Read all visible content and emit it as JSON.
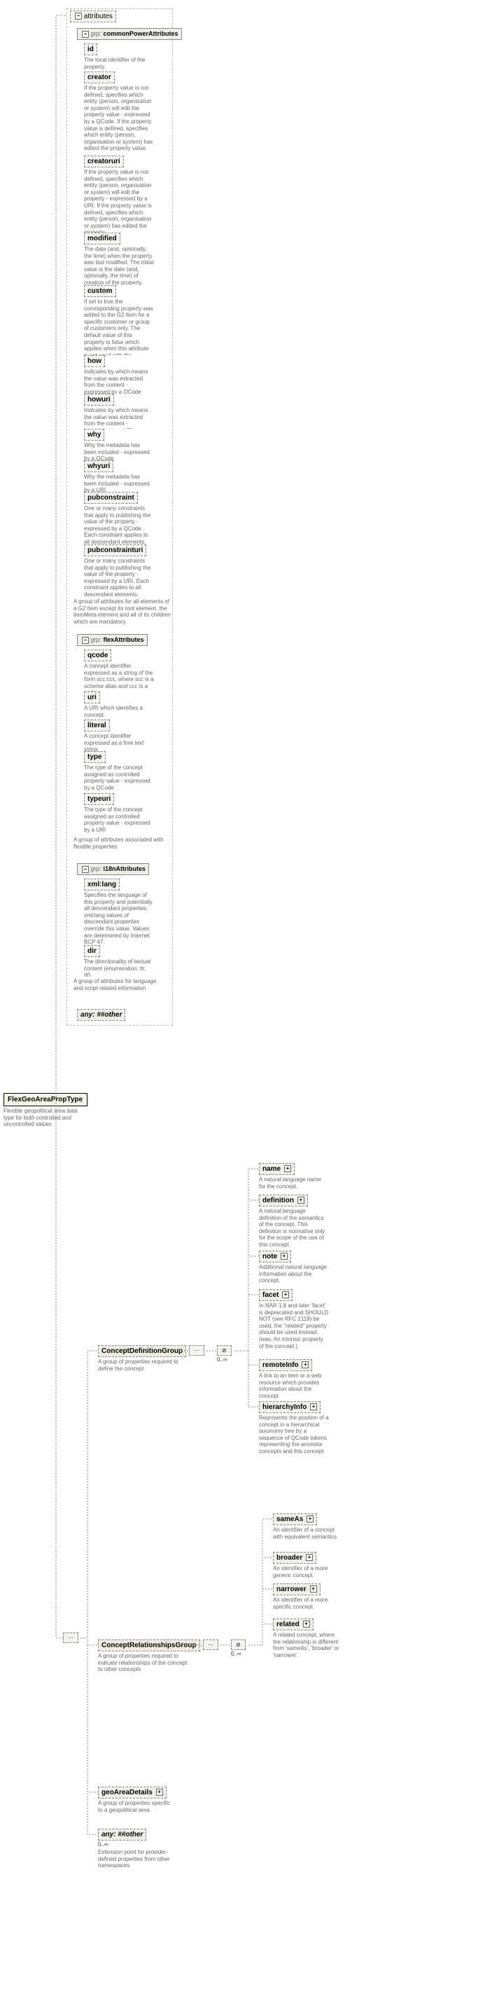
{
  "root": {
    "name": "FlexGeoAreaPropType",
    "desc": "Flexible geopolitical area data type for both controlled and uncontrolled values"
  },
  "attributes_label": "attributes",
  "grp_prefix": "grp:",
  "any_prefix": "any:",
  "toggle_plus": "+",
  "toggle_minus": "−",
  "seq_dots": "···",
  "groups": {
    "commonPower": {
      "name": "commonPowerAttributes",
      "desc": "A group of attributes for all elements of a G2 Item except its root element, the itemMeta element and all of its children which are mandatory.",
      "attrs": [
        {
          "name": "id",
          "desc": "The local identifier of the property."
        },
        {
          "name": "creator",
          "desc": "If the property value is not defined, specifies which entity (person, organisation or system) will edit the property value - expressed by a QCode. If the property value is defined, specifies which entity (person, organisation or system) has edited the property value."
        },
        {
          "name": "creatoruri",
          "desc": "If the property value is not defined, specifies which entity (person, organisation or system) will edit the property - expressed by a URI. If the property value is defined, specifies which entity (person, organisation or system) has edited the property."
        },
        {
          "name": "modified",
          "desc": "The date (and, optionally, the time) when the property was last modified. The initial value is the date (and, optionally, the time) of creation of the property."
        },
        {
          "name": "custom",
          "desc": "If set to true the corresponding property was added to the G2 Item for a specific customer or group of customers only. The default value of this property is false which applies when this attribute is not used with the property."
        },
        {
          "name": "how",
          "desc": "Indicates by which means the value was extracted from the content - expressed by a QCode"
        },
        {
          "name": "howuri",
          "desc": "Indicates by which means the value was extracted from the content - expressed by a URI"
        },
        {
          "name": "why",
          "desc": "Why the metadata has been included - expressed by a QCode"
        },
        {
          "name": "whyuri",
          "desc": "Why the metadata has been included - expressed by a URI"
        },
        {
          "name": "pubconstraint",
          "desc": "One or many constraints that apply to publishing the value of the property - expressed by a QCode. Each constraint applies to all descendant elements."
        },
        {
          "name": "pubconstrainturi",
          "desc": "One or many constraints that apply to publishing the value of the property - expressed by a URI. Each constraint applies to all descendant elements."
        }
      ]
    },
    "flex": {
      "name": "flexAttributes",
      "desc": "A group of attributes associated with flexible properties",
      "attrs": [
        {
          "name": "qcode",
          "desc": "A concept identifier expressed as a string of the form scc:ccc, where scc is a scheme alias and ccc is a code"
        },
        {
          "name": "uri",
          "desc": "A URI which identifies a concept."
        },
        {
          "name": "literal",
          "desc": "A concept identifier expressed as a free text string"
        },
        {
          "name": "type",
          "desc": "The type of the concept assigned as controlled property value - expressed by a QCode"
        },
        {
          "name": "typeuri",
          "desc": "The type of the concept assigned as controlled property value - expressed by a URI"
        }
      ]
    },
    "i18n": {
      "name": "i18nAttributes",
      "desc": "A group of attributes for language and script related information",
      "attrs": [
        {
          "name": "xml:lang",
          "desc": "Specifies the language of this property and potentially all descendant properties. xml:lang values of descendant properties override this value. Values are determined by Internet BCP 47."
        },
        {
          "name": "dir",
          "desc": "The directionality of textual content (enumeration: ltr, rtl)"
        }
      ]
    }
  },
  "any_other": "##other",
  "conceptDef": {
    "name": "ConceptDefinitionGroup",
    "desc": "A group of properties required to define the concept",
    "card": "0..∞",
    "elems": [
      {
        "name": "name",
        "desc": "A natural language name for the concept."
      },
      {
        "name": "definition",
        "desc": "A natural language definition of the semantics of the concept. This definition is normative only for the scope of the use of this concept."
      },
      {
        "name": "note",
        "desc": "Additional natural language information about the concept."
      },
      {
        "name": "facet",
        "desc": "In NAR 1.8 and later 'facet' is deprecated and SHOULD NOT (see RFC 2119) be used, the \"related\" property should be used instead. (was: An intrinsic property of the concept.)"
      },
      {
        "name": "remoteInfo",
        "desc": "A link to an item or a web resource which provides information about the concept"
      },
      {
        "name": "hierarchyInfo",
        "desc": "Represents the position of a concept in a hierarchical taxonomy tree by a sequence of QCode tokens representing the ancestor concepts and this concept"
      }
    ]
  },
  "conceptRel": {
    "name": "ConceptRelationshipsGroup",
    "desc": "A group of properties required to indicate relationships of the concept to other concepts",
    "card": "0..∞",
    "elems": [
      {
        "name": "sameAs",
        "desc": "An identifier of a concept with equivalent semantics"
      },
      {
        "name": "broader",
        "desc": "An identifier of a more generic concept."
      },
      {
        "name": "narrower",
        "desc": "An identifier of a more specific concept."
      },
      {
        "name": "related",
        "desc": "A related concept, where the relationship is different from 'sameAs', 'broader' or 'narrower'."
      }
    ]
  },
  "geoArea": {
    "name": "geoAreaDetails",
    "desc": "A group of properties specific to a geopolitical area."
  },
  "extension": {
    "name": "##other",
    "desc": "Extension point for provider-defined properties from other namespaces",
    "card": "0..∞"
  }
}
